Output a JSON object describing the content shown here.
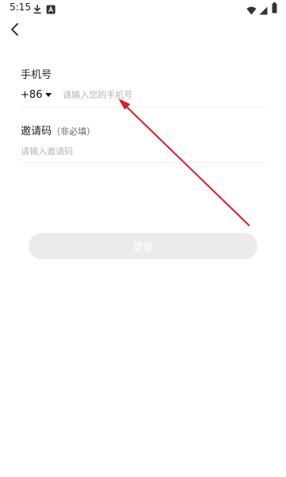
{
  "status_bar": {
    "time": "5:15",
    "icons": [
      "download-icon",
      "app-notification-icon",
      "wifi-icon",
      "signal-icon",
      "battery-icon"
    ]
  },
  "nav": {
    "back_icon": "chevron-left-icon"
  },
  "form": {
    "phone_label": "手机号",
    "country_code": "+86",
    "phone_placeholder": "请输入您的手机号",
    "invite_label": "邀请码",
    "invite_note": "（非必填）",
    "invite_placeholder": "请输入邀请码"
  },
  "login_button": {
    "label": "登录"
  },
  "annotation": {
    "color": "#d0202a"
  }
}
